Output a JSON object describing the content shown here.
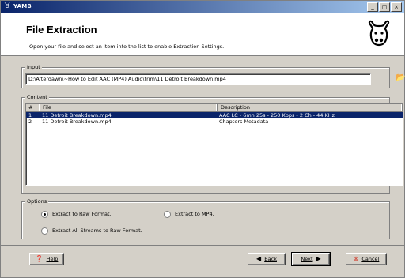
{
  "window": {
    "title": "YAMB",
    "min": "_",
    "max": "□",
    "close": "×"
  },
  "header": {
    "title": "File Extraction",
    "subtitle": "Open your file and select an item into the list to enable Extraction Settings."
  },
  "input": {
    "legend": "Input",
    "path": "D:\\Afterdawn\\~How to Edit AAC (MP4) Audio\\trim\\11 Detroit Breakdown.mp4"
  },
  "content": {
    "legend": "Content",
    "columns": [
      "#",
      "File",
      "Description"
    ],
    "rows": [
      {
        "num": "1",
        "file": "11 Detroit Breakdown.mp4",
        "desc": "AAC LC - 6mn 25s - 250 Kbps - 2 Ch - 44 KHz",
        "selected": true
      },
      {
        "num": "2",
        "file": "11 Detroit Breakdown.mp4",
        "desc": "Chapters Metadata",
        "selected": false
      }
    ]
  },
  "options": {
    "legend": "Options",
    "raw": "Extract to Raw Format.",
    "mp4": "Extract to MP4.",
    "all": "Extract All Streams to Raw Format.",
    "selected": "raw"
  },
  "buttons": {
    "help": "Help",
    "back": "Back",
    "next": "Next",
    "cancel": "Cancel"
  }
}
